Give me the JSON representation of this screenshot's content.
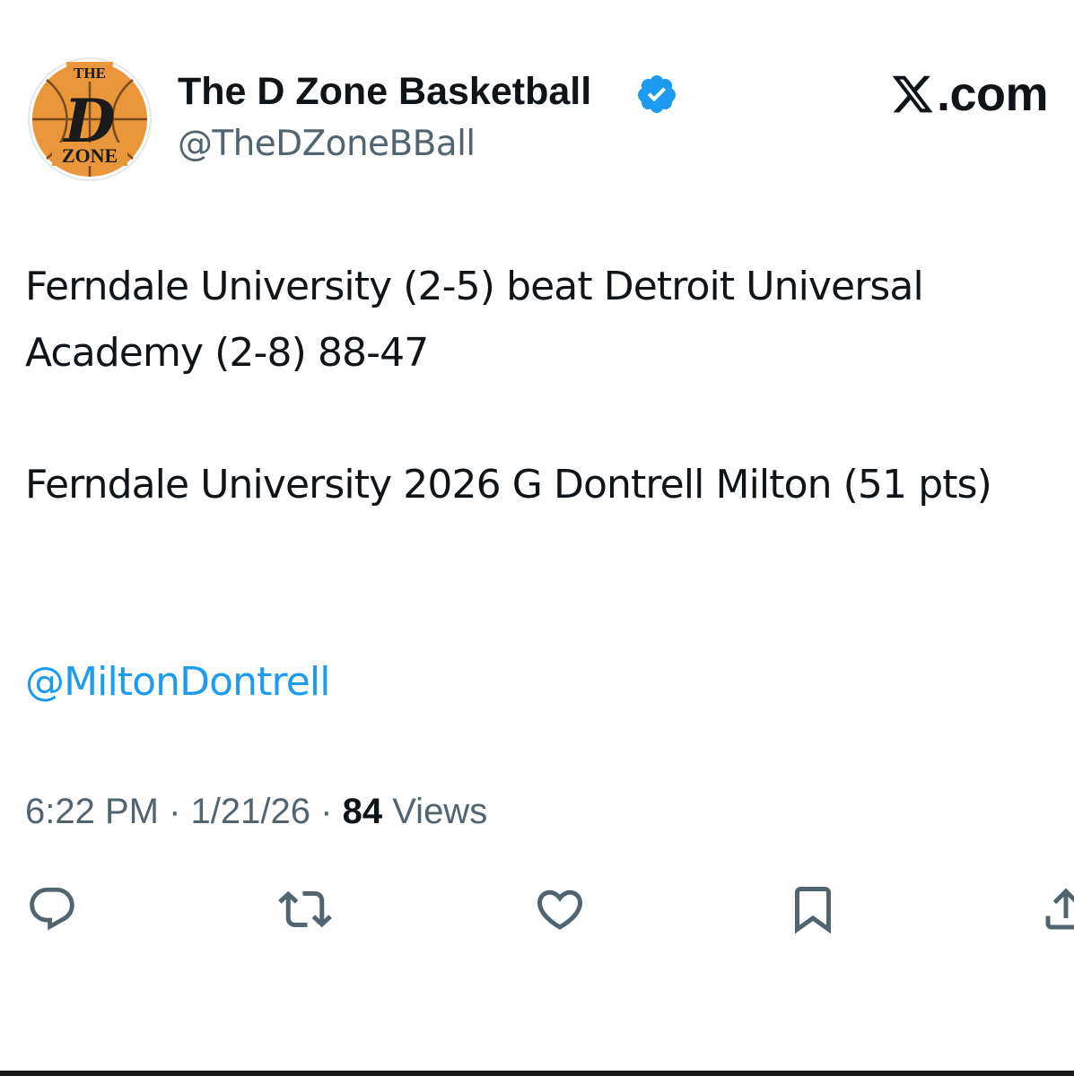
{
  "author": {
    "display_name": "The D Zone Basketball",
    "handle": "@TheDZoneBBall",
    "verified": true,
    "avatar": {
      "logo_top": "THE",
      "logo_letter": "D",
      "logo_bottom": "ZONE",
      "colors": {
        "ball": "#e9973a",
        "seams": "#7a4a1c",
        "ink": "#1b1b1b"
      }
    }
  },
  "brand": {
    "icon": "x-logo-icon",
    "label": ".com"
  },
  "post": {
    "paragraphs": [
      "Ferndale University (2-5) beat Detroit Universal Academy (2-8) 88-47",
      "Ferndale University 2026 G Dontrell Milton  (51 pts)"
    ],
    "mention": "@MiltonDontrell"
  },
  "meta": {
    "time": "6:22 PM",
    "separator": "·",
    "date": "1/21/26",
    "views_count": "84",
    "views_label": "Views"
  },
  "actions": [
    {
      "name": "reply",
      "icon": "reply-icon"
    },
    {
      "name": "retweet",
      "icon": "retweet-icon"
    },
    {
      "name": "like",
      "icon": "heart-icon"
    },
    {
      "name": "bookmark",
      "icon": "bookmark-icon"
    },
    {
      "name": "share",
      "icon": "share-icon"
    }
  ],
  "colors": {
    "text": "#0f1419",
    "secondary": "#536471",
    "link": "#1d9bf0",
    "verified": "#1d9bf0"
  }
}
